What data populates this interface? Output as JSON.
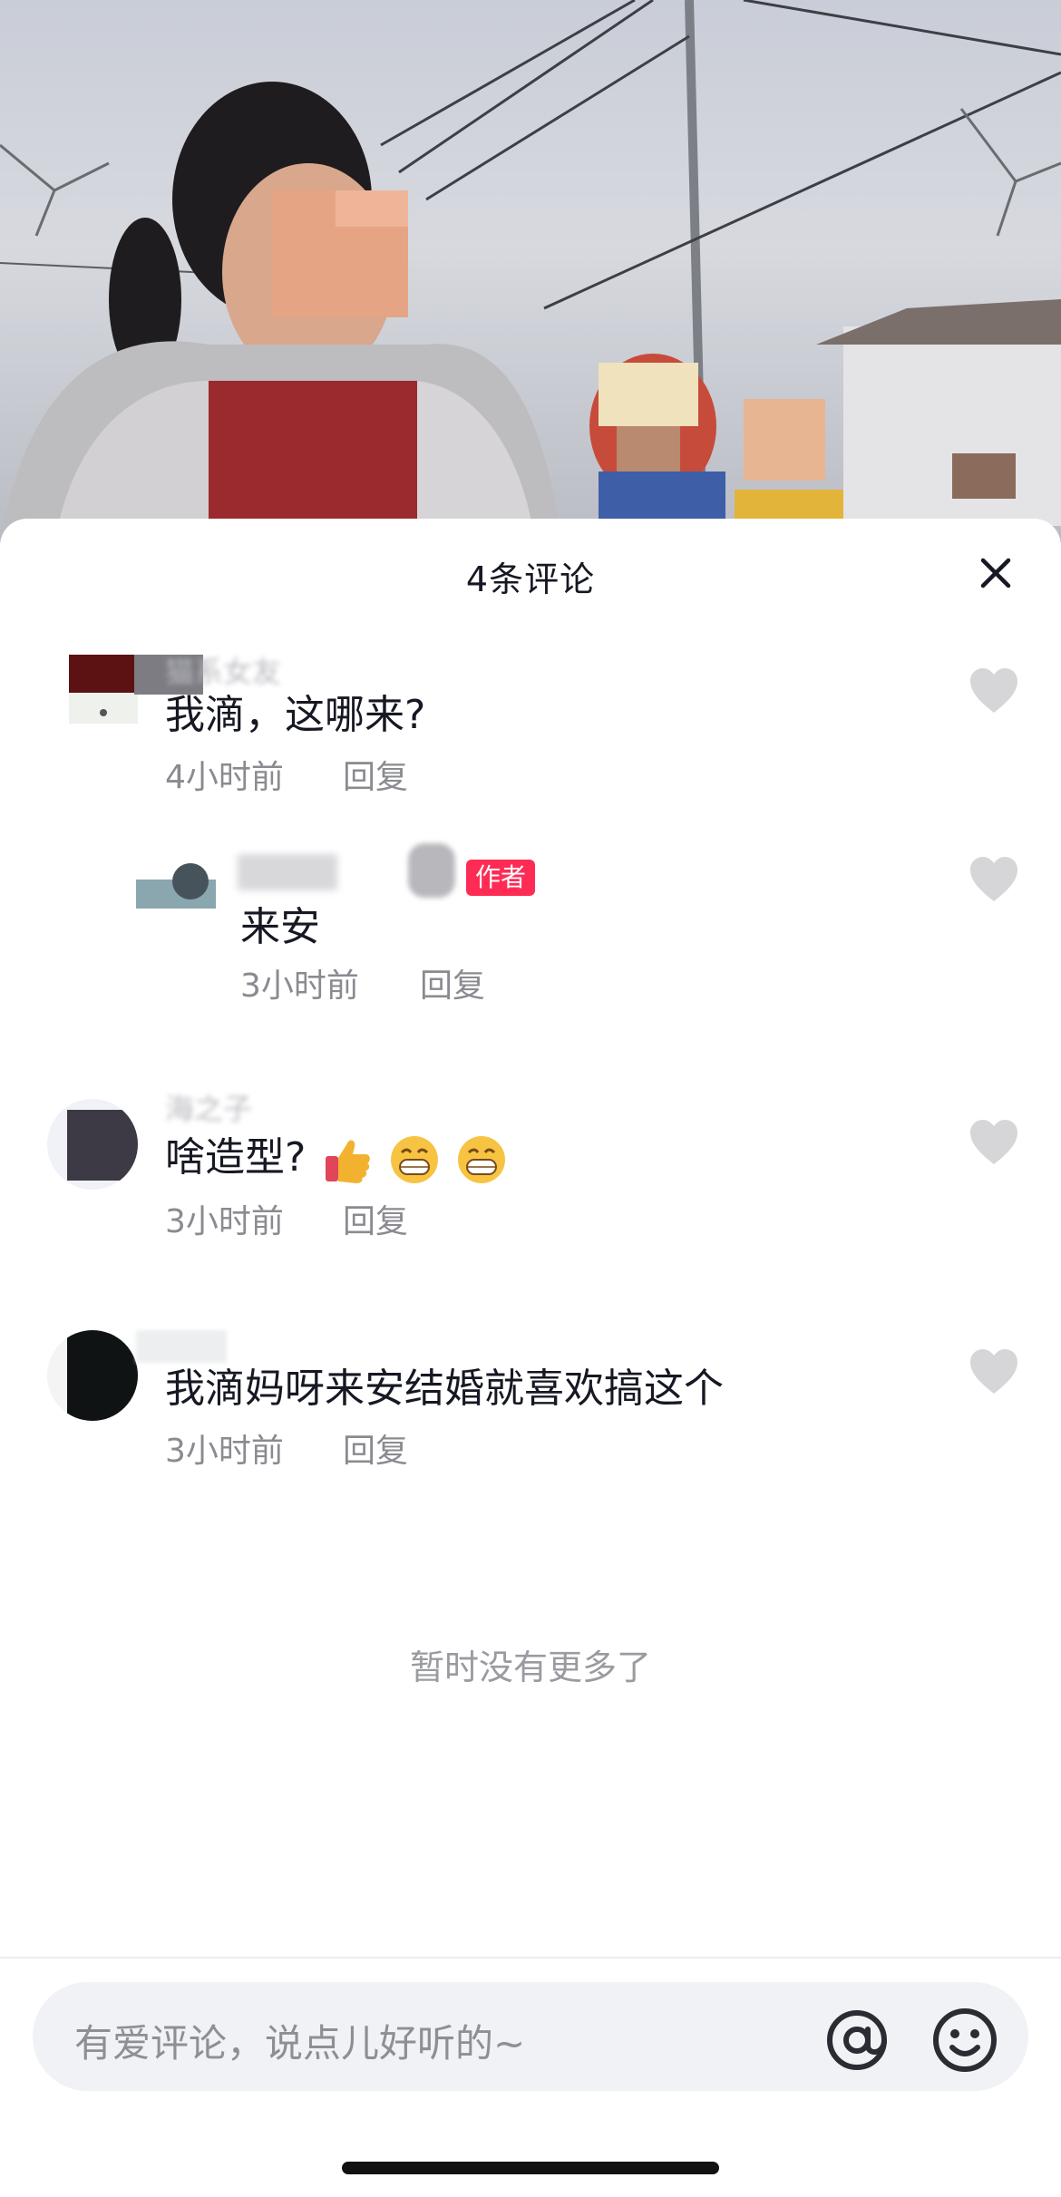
{
  "header": {
    "title": "4条评论"
  },
  "comments": [
    {
      "text": "我滴，这哪来?",
      "time": "4小时前",
      "reply_label": "回复",
      "username": "猫系女友"
    },
    {
      "text": "来安",
      "time": "3小时前",
      "reply_label": "回复",
      "badge": "作者",
      "username": "作者"
    },
    {
      "text": "啥造型?",
      "time": "3小时前",
      "reply_label": "回复",
      "username": "海之子"
    },
    {
      "text": "我滴妈呀来安结婚就喜欢搞这个",
      "time": "3小时前",
      "reply_label": "回复",
      "username": ""
    }
  ],
  "footer": {
    "no_more": "暂时没有更多了"
  },
  "input": {
    "placeholder": "有爱评论，说点儿好听的~"
  },
  "icons": {
    "close": "close-icon",
    "like": "heart-icon",
    "mention": "at-icon",
    "emoji": "smiley-icon",
    "thumbs_up": "thumbs-up-emoji",
    "grin": "grin-emoji"
  },
  "colors": {
    "author_badge": "#fe2c55",
    "text": "#161823",
    "meta": "#8a8b91"
  }
}
